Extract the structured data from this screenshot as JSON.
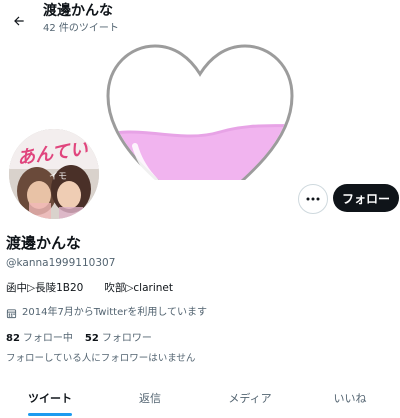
{
  "header": {
    "back_icon": "arrow-left-icon",
    "name": "渡邊かんな",
    "tweet_count": "42 件のツイート"
  },
  "banner": {
    "image": "pink-heart-hourglass-illustration"
  },
  "avatar": {
    "image": "profile-photo-with-handwritten-text",
    "handwriting": "あんてい"
  },
  "actions": {
    "more_icon": "ellipsis-icon",
    "follow_label": "フォロー"
  },
  "profile": {
    "display_name": "渡邊かんな",
    "handle": "@kanna1999110307",
    "bio": "函中▷長陵1B20　　吹部▷clarinet",
    "joined_icon": "calendar-icon",
    "joined": "2014年7月からTwitterを利用しています",
    "following_count": "82",
    "following_label": "フォロー中",
    "followers_count": "52",
    "followers_label": "フォロワー",
    "mutual_note": "フォローしている人にフォロワーはいません"
  },
  "tabs": [
    {
      "label": "ツイート",
      "active": true
    },
    {
      "label": "返信",
      "active": false
    },
    {
      "label": "メディア",
      "active": false
    },
    {
      "label": "いいね",
      "active": false
    }
  ],
  "colors": {
    "accent": "#1d9bf0",
    "text": "#0f1419",
    "muted": "#536471",
    "heart_fill": "#f1b4ef"
  }
}
